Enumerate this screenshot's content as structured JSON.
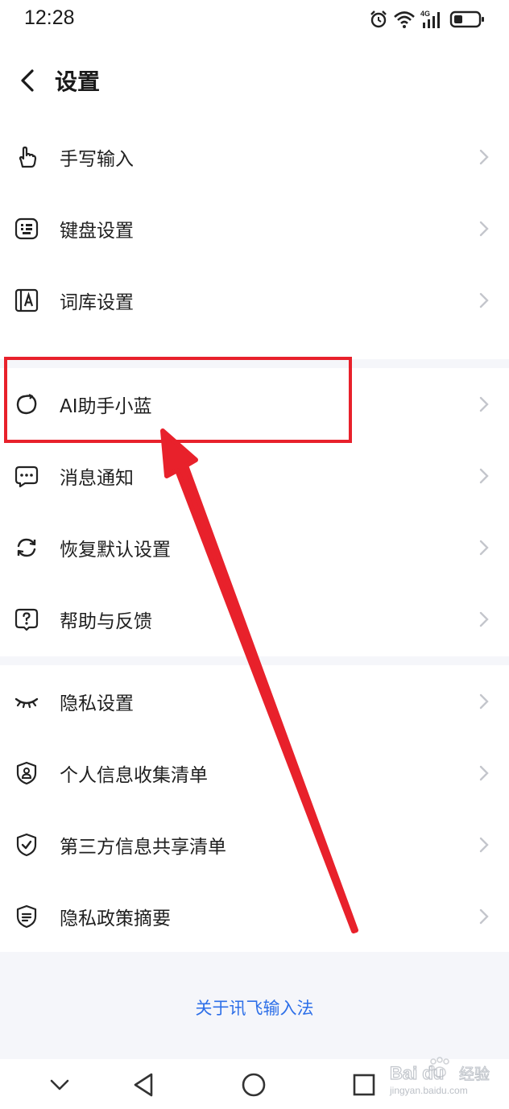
{
  "status_bar": {
    "time": "12:28",
    "icons": [
      "alarm-icon",
      "wifi-icon",
      "signal-4g-icon",
      "battery-icon"
    ],
    "network_label": "4G"
  },
  "header": {
    "back_icon": "chevron-left-icon",
    "title": "设置"
  },
  "groups": [
    {
      "items": [
        {
          "label": "手写输入",
          "icon": "handwriting-hand-icon"
        },
        {
          "label": "键盘设置",
          "icon": "keyboard-icon"
        },
        {
          "label": "词库设置",
          "icon": "dictionary-icon"
        }
      ]
    },
    {
      "items": [
        {
          "label": "AI助手小蓝",
          "icon": "ai-assistant-icon"
        },
        {
          "label": "消息通知",
          "icon": "message-bubble-icon"
        },
        {
          "label": "恢复默认设置",
          "icon": "reset-icon"
        },
        {
          "label": "帮助与反馈",
          "icon": "help-icon"
        }
      ]
    },
    {
      "items": [
        {
          "label": "隐私设置",
          "icon": "closed-eye-icon"
        },
        {
          "label": "个人信息收集清单",
          "icon": "shield-user-icon"
        },
        {
          "label": "第三方信息共享清单",
          "icon": "shield-check-icon"
        },
        {
          "label": "隐私政策摘要",
          "icon": "shield-doc-icon"
        }
      ]
    }
  ],
  "about_link": "关于讯飞输入法",
  "nav_bar": {
    "buttons": [
      "hide-keyboard-icon",
      "back-triangle-icon",
      "home-circle-icon",
      "recents-square-icon"
    ]
  },
  "annotation": {
    "highlight_color": "#e8212b"
  },
  "watermark": {
    "brand": "Bai du 经验",
    "url": "jingyan.baidu.com"
  },
  "colors": {
    "accent_link": "#2d6fe8",
    "background": "#f5f6fa"
  }
}
